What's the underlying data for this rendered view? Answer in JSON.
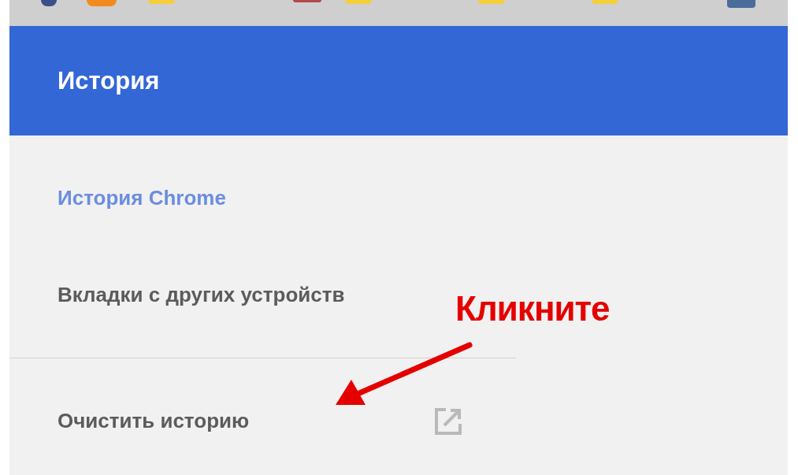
{
  "header": {
    "title": "История"
  },
  "nav": {
    "items": [
      {
        "label": "История Chrome",
        "selected": true,
        "kind": "link"
      },
      {
        "label": "Вкладки с других устройств",
        "selected": false,
        "kind": "link"
      },
      {
        "label": "Очистить историю",
        "selected": false,
        "kind": "external"
      }
    ]
  },
  "annotation": {
    "text": "Кликните"
  }
}
